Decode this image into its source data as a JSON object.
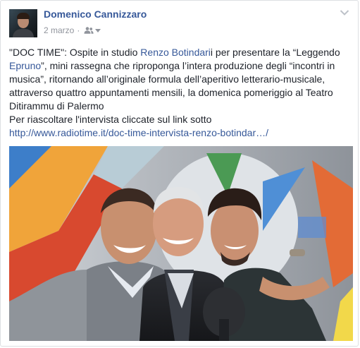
{
  "post": {
    "author": "Domenico Cannizzaro",
    "date": "2 marzo",
    "separator": "·",
    "audience_icon": "friends-icon",
    "options_icon": "chevron-down-icon",
    "body": {
      "part1": "\"DOC TIME\": Ospite in studio ",
      "mention1": "Renzo Botindari",
      "part2": "i per presentare la “Leggendo ",
      "mention2": "Epruno",
      "part3": "”, mini rassegna che riproponga l’intera produzione degli “incontri in musica”, ritornando all’originale formula dell’aperitivo letterario-musicale, attraverso quattro appuntamenti mensili, la domenica pomeriggio al Teatro Ditirammu di Palermo",
      "line2": "Per riascoltare l'intervista cliccate sul link sotto",
      "link": "http://www.radiotime.it/doc-time-intervista-renzo-botindar…/"
    },
    "photo": {
      "icon": "photo-icon"
    }
  },
  "colors": {
    "link": "#365899",
    "meta": "#90949c",
    "text": "#1d2129",
    "border": "#dddfe2"
  }
}
